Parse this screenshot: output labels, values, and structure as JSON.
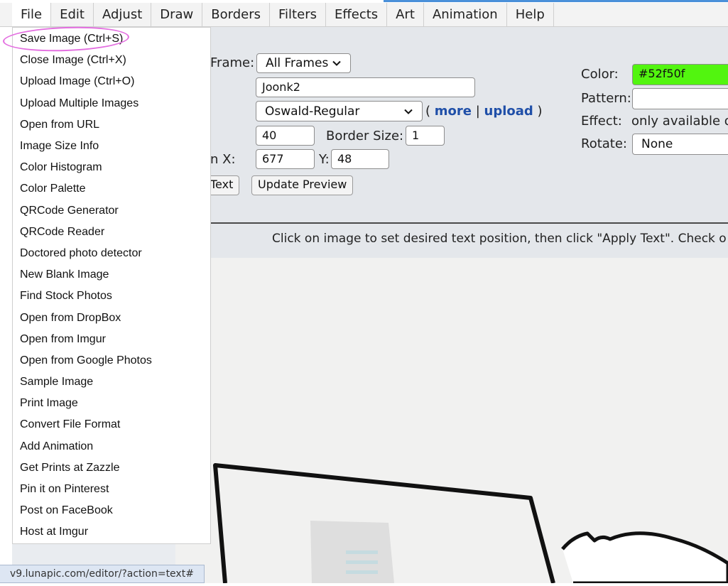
{
  "menubar": {
    "items": [
      "File",
      "Edit",
      "Adjust",
      "Draw",
      "Borders",
      "Filters",
      "Effects",
      "Art",
      "Animation",
      "Help"
    ]
  },
  "file_menu": {
    "items": [
      "Save Image (Ctrl+S)",
      "Close Image (Ctrl+X)",
      "Upload Image (Ctrl+O)",
      "Upload Multiple Images",
      "Open from URL",
      "Image Size Info",
      "Color Histogram",
      "Color Palette",
      "QRCode Generator",
      "QRCode Reader",
      "Doctored photo detector",
      "New Blank Image",
      "Find Stock Photos",
      "Open from DropBox",
      "Open from Imgur",
      "Open from Google Photos",
      "Sample Image",
      "Print Image",
      "Convert File Format",
      "Add Animation",
      "Get Prints at Zazzle",
      "Pin it on Pinterest",
      "Post on FaceBook",
      "Host at Imgur"
    ]
  },
  "text_tool": {
    "frame_label": "Frame:",
    "frame_value": "All Frames",
    "text_value": "Joonk2",
    "font_value": "Oswald-Regular",
    "paren_open": "(",
    "more_link": "more",
    "separator": "|",
    "upload_link": "upload",
    "paren_close": ")",
    "size_value": "40",
    "border_size_label": "Border Size:",
    "border_size_value": "1",
    "position_x_label": "n X:",
    "position_x_value": "677",
    "position_y_label": "Y:",
    "position_y_value": "48",
    "apply_text_button": "Text",
    "update_preview_button": "Update Preview",
    "color_label": "Color:",
    "color_value": "#52f50f",
    "color_hex": "#52f50f",
    "pattern_label": "Pattern:",
    "effect_label": "Effect:",
    "effect_value": "only available or",
    "rotate_label": "Rotate:",
    "rotate_value": "None"
  },
  "hint": "Click on image to set desired text position, then click \"Apply Text\". Check o",
  "status_bar": "v9.lunapic.com/editor/?action=text#"
}
